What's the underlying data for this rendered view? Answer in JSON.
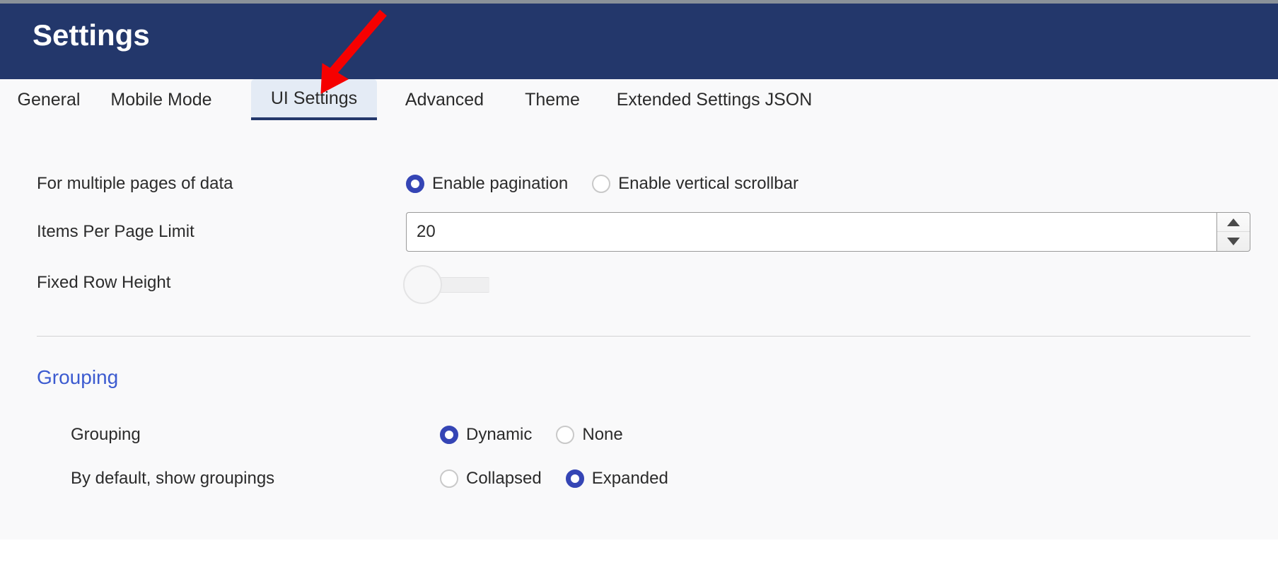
{
  "header": {
    "title": "Settings",
    "bg_color": "#23376b"
  },
  "tabs": [
    {
      "label": "General",
      "active": false
    },
    {
      "label": "Mobile Mode",
      "active": false
    },
    {
      "label": "UI Settings",
      "active": true
    },
    {
      "label": "Advanced",
      "active": false
    },
    {
      "label": "Theme",
      "active": false
    },
    {
      "label": "Extended Settings JSON",
      "active": false
    }
  ],
  "ui_settings": {
    "pagination_row": {
      "label": "For multiple pages of data",
      "options": [
        {
          "label": "Enable pagination",
          "selected": true
        },
        {
          "label": "Enable vertical scrollbar",
          "selected": false
        }
      ]
    },
    "items_per_page": {
      "label": "Items Per Page Limit",
      "value": "20",
      "placeholder": "",
      "spinner_up": "increment",
      "spinner_down": "decrement"
    },
    "fixed_row_height": {
      "label": "Fixed Row Height",
      "enabled": false
    }
  },
  "grouping_section": {
    "title": "Grouping",
    "title_color": "#3c5bd0",
    "rows": [
      {
        "label": "Grouping",
        "options": [
          {
            "label": "Dynamic",
            "selected": true
          },
          {
            "label": "None",
            "selected": false
          }
        ]
      },
      {
        "label": "By default, show groupings",
        "options": [
          {
            "label": "Collapsed",
            "selected": false
          },
          {
            "label": "Expanded",
            "selected": true
          }
        ]
      }
    ]
  },
  "annotation": {
    "arrow_color": "#f60000",
    "points_to": "UI Settings"
  }
}
